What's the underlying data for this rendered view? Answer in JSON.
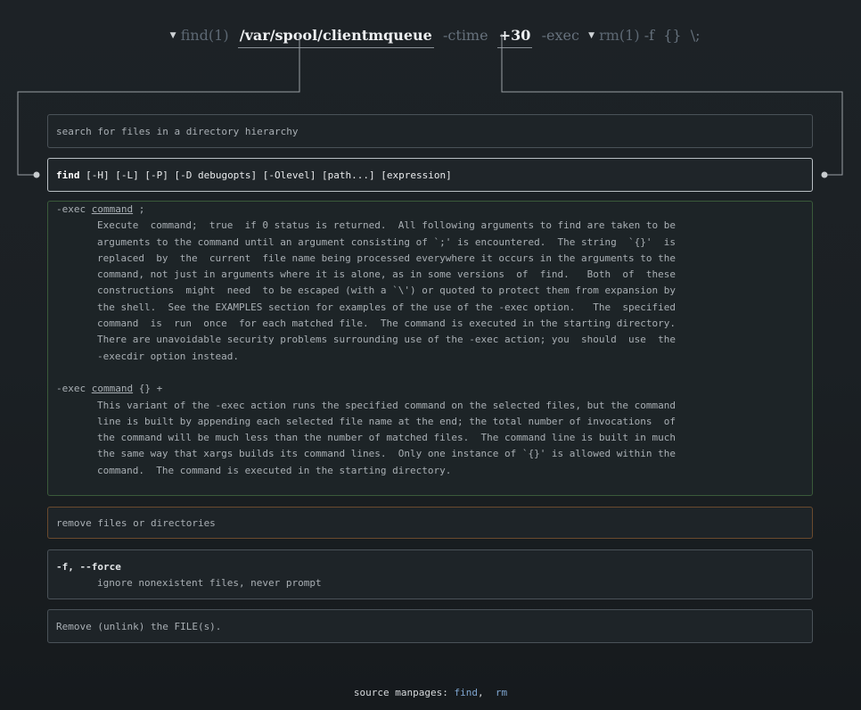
{
  "command": {
    "find_prog": "find(1)",
    "path_arg": "/var/spool/clientmqueue",
    "ctime_opt": "-ctime",
    "ctime_val": "+30",
    "exec_opt": "-exec",
    "rm_prog": "rm(1)",
    "f_opt": "-f",
    "braces": "{}",
    "terminator": "\\;"
  },
  "find": {
    "description": "search for files in a directory hierarchy",
    "synopsis_name": "find",
    "synopsis_rest": " [-H] [-L] [-P] [-D debugopts] [-Olevel] [path...] [expression]"
  },
  "exec_help": {
    "opt1_head_pre": "-exec ",
    "opt1_head_cmd": "command",
    "opt1_head_post": " ;",
    "opt1_body": [
      "Execute  command;  true  if 0 status is returned.  All following arguments to find are taken to be",
      "arguments to the command until an argument consisting of `;' is encountered.  The string  `{}'  is",
      "replaced  by  the  current  file name being processed everywhere it occurs in the arguments to the",
      "command, not just in arguments where it is alone, as in some versions  of  find.   Both  of  these",
      "constructions  might  need  to be escaped (with a `\\') or quoted to protect them from expansion by",
      "the shell.  See the EXAMPLES section for examples of the use of the -exec option.   The  specified",
      "command  is  run  once  for each matched file.  The command is executed in the starting directory.",
      "There are unavoidable security problems surrounding use of the -exec action; you  should  use  the",
      "-execdir option instead."
    ],
    "opt2_head_pre": "-exec ",
    "opt2_head_cmd": "command",
    "opt2_head_post": " {} +",
    "opt2_body": [
      "This variant of the -exec action runs the specified command on the selected files, but the command",
      "line is built by appending each selected file name at the end; the total number of invocations  of",
      "the command will be much less than the number of matched files.  The command line is built in much",
      "the same way that xargs builds its command lines.  Only one instance of `{}' is allowed within the",
      "command.  The command is executed in the starting directory."
    ]
  },
  "rm": {
    "description": "remove files or directories",
    "force_opt": "-f, --force",
    "force_desc": "ignore nonexistent files, never prompt",
    "remove_desc": "Remove (unlink) the FILE(s)."
  },
  "footer": {
    "label": "source manpages: ",
    "link_find": "find",
    "sep": ",",
    "link_rm": "rm"
  },
  "icons": {
    "caret": "triangle-down",
    "connector_dot": "filled-circle"
  }
}
